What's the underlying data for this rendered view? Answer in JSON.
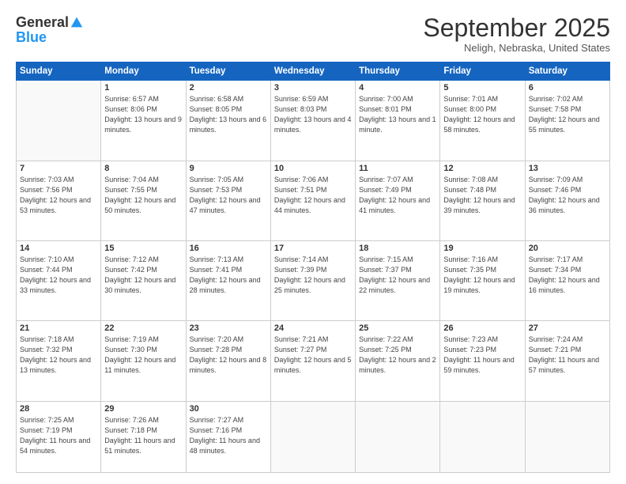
{
  "logo": {
    "general": "General",
    "blue": "Blue"
  },
  "header": {
    "month": "September 2025",
    "location": "Neligh, Nebraska, United States"
  },
  "weekdays": [
    "Sunday",
    "Monday",
    "Tuesday",
    "Wednesday",
    "Thursday",
    "Friday",
    "Saturday"
  ],
  "weeks": [
    [
      {
        "day": "",
        "sunrise": "",
        "sunset": "",
        "daylight": ""
      },
      {
        "day": "1",
        "sunrise": "Sunrise: 6:57 AM",
        "sunset": "Sunset: 8:06 PM",
        "daylight": "Daylight: 13 hours and 9 minutes."
      },
      {
        "day": "2",
        "sunrise": "Sunrise: 6:58 AM",
        "sunset": "Sunset: 8:05 PM",
        "daylight": "Daylight: 13 hours and 6 minutes."
      },
      {
        "day": "3",
        "sunrise": "Sunrise: 6:59 AM",
        "sunset": "Sunset: 8:03 PM",
        "daylight": "Daylight: 13 hours and 4 minutes."
      },
      {
        "day": "4",
        "sunrise": "Sunrise: 7:00 AM",
        "sunset": "Sunset: 8:01 PM",
        "daylight": "Daylight: 13 hours and 1 minute."
      },
      {
        "day": "5",
        "sunrise": "Sunrise: 7:01 AM",
        "sunset": "Sunset: 8:00 PM",
        "daylight": "Daylight: 12 hours and 58 minutes."
      },
      {
        "day": "6",
        "sunrise": "Sunrise: 7:02 AM",
        "sunset": "Sunset: 7:58 PM",
        "daylight": "Daylight: 12 hours and 55 minutes."
      }
    ],
    [
      {
        "day": "7",
        "sunrise": "Sunrise: 7:03 AM",
        "sunset": "Sunset: 7:56 PM",
        "daylight": "Daylight: 12 hours and 53 minutes."
      },
      {
        "day": "8",
        "sunrise": "Sunrise: 7:04 AM",
        "sunset": "Sunset: 7:55 PM",
        "daylight": "Daylight: 12 hours and 50 minutes."
      },
      {
        "day": "9",
        "sunrise": "Sunrise: 7:05 AM",
        "sunset": "Sunset: 7:53 PM",
        "daylight": "Daylight: 12 hours and 47 minutes."
      },
      {
        "day": "10",
        "sunrise": "Sunrise: 7:06 AM",
        "sunset": "Sunset: 7:51 PM",
        "daylight": "Daylight: 12 hours and 44 minutes."
      },
      {
        "day": "11",
        "sunrise": "Sunrise: 7:07 AM",
        "sunset": "Sunset: 7:49 PM",
        "daylight": "Daylight: 12 hours and 41 minutes."
      },
      {
        "day": "12",
        "sunrise": "Sunrise: 7:08 AM",
        "sunset": "Sunset: 7:48 PM",
        "daylight": "Daylight: 12 hours and 39 minutes."
      },
      {
        "day": "13",
        "sunrise": "Sunrise: 7:09 AM",
        "sunset": "Sunset: 7:46 PM",
        "daylight": "Daylight: 12 hours and 36 minutes."
      }
    ],
    [
      {
        "day": "14",
        "sunrise": "Sunrise: 7:10 AM",
        "sunset": "Sunset: 7:44 PM",
        "daylight": "Daylight: 12 hours and 33 minutes."
      },
      {
        "day": "15",
        "sunrise": "Sunrise: 7:12 AM",
        "sunset": "Sunset: 7:42 PM",
        "daylight": "Daylight: 12 hours and 30 minutes."
      },
      {
        "day": "16",
        "sunrise": "Sunrise: 7:13 AM",
        "sunset": "Sunset: 7:41 PM",
        "daylight": "Daylight: 12 hours and 28 minutes."
      },
      {
        "day": "17",
        "sunrise": "Sunrise: 7:14 AM",
        "sunset": "Sunset: 7:39 PM",
        "daylight": "Daylight: 12 hours and 25 minutes."
      },
      {
        "day": "18",
        "sunrise": "Sunrise: 7:15 AM",
        "sunset": "Sunset: 7:37 PM",
        "daylight": "Daylight: 12 hours and 22 minutes."
      },
      {
        "day": "19",
        "sunrise": "Sunrise: 7:16 AM",
        "sunset": "Sunset: 7:35 PM",
        "daylight": "Daylight: 12 hours and 19 minutes."
      },
      {
        "day": "20",
        "sunrise": "Sunrise: 7:17 AM",
        "sunset": "Sunset: 7:34 PM",
        "daylight": "Daylight: 12 hours and 16 minutes."
      }
    ],
    [
      {
        "day": "21",
        "sunrise": "Sunrise: 7:18 AM",
        "sunset": "Sunset: 7:32 PM",
        "daylight": "Daylight: 12 hours and 13 minutes."
      },
      {
        "day": "22",
        "sunrise": "Sunrise: 7:19 AM",
        "sunset": "Sunset: 7:30 PM",
        "daylight": "Daylight: 12 hours and 11 minutes."
      },
      {
        "day": "23",
        "sunrise": "Sunrise: 7:20 AM",
        "sunset": "Sunset: 7:28 PM",
        "daylight": "Daylight: 12 hours and 8 minutes."
      },
      {
        "day": "24",
        "sunrise": "Sunrise: 7:21 AM",
        "sunset": "Sunset: 7:27 PM",
        "daylight": "Daylight: 12 hours and 5 minutes."
      },
      {
        "day": "25",
        "sunrise": "Sunrise: 7:22 AM",
        "sunset": "Sunset: 7:25 PM",
        "daylight": "Daylight: 12 hours and 2 minutes."
      },
      {
        "day": "26",
        "sunrise": "Sunrise: 7:23 AM",
        "sunset": "Sunset: 7:23 PM",
        "daylight": "Daylight: 11 hours and 59 minutes."
      },
      {
        "day": "27",
        "sunrise": "Sunrise: 7:24 AM",
        "sunset": "Sunset: 7:21 PM",
        "daylight": "Daylight: 11 hours and 57 minutes."
      }
    ],
    [
      {
        "day": "28",
        "sunrise": "Sunrise: 7:25 AM",
        "sunset": "Sunset: 7:19 PM",
        "daylight": "Daylight: 11 hours and 54 minutes."
      },
      {
        "day": "29",
        "sunrise": "Sunrise: 7:26 AM",
        "sunset": "Sunset: 7:18 PM",
        "daylight": "Daylight: 11 hours and 51 minutes."
      },
      {
        "day": "30",
        "sunrise": "Sunrise: 7:27 AM",
        "sunset": "Sunset: 7:16 PM",
        "daylight": "Daylight: 11 hours and 48 minutes."
      },
      {
        "day": "",
        "sunrise": "",
        "sunset": "",
        "daylight": ""
      },
      {
        "day": "",
        "sunrise": "",
        "sunset": "",
        "daylight": ""
      },
      {
        "day": "",
        "sunrise": "",
        "sunset": "",
        "daylight": ""
      },
      {
        "day": "",
        "sunrise": "",
        "sunset": "",
        "daylight": ""
      }
    ]
  ]
}
